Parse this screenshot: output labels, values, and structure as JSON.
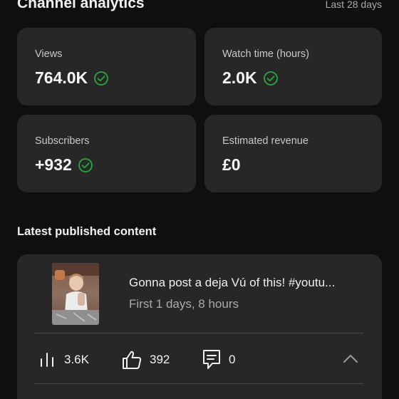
{
  "header": {
    "title": "Channel analytics",
    "range": "Last 28 days"
  },
  "metrics": [
    {
      "label": "Views",
      "value": "764.0K",
      "verified": true
    },
    {
      "label": "Watch time (hours)",
      "value": "2.0K",
      "verified": true
    },
    {
      "label": "Subscribers",
      "value": "+932",
      "verified": true
    },
    {
      "label": "Estimated revenue",
      "value": "£0",
      "verified": false
    }
  ],
  "latest": {
    "section_title": "Latest published content",
    "video": {
      "title": "Gonna post a deja Vú of this! #youtu...",
      "age": "First 1 days, 8 hours",
      "views": "3.6K",
      "likes": "392",
      "comments": "0"
    }
  },
  "icons": {
    "check": "check-circle-icon",
    "views": "bar-chart-icon",
    "likes": "thumbs-up-icon",
    "comments": "comment-icon",
    "collapse": "chevron-up-icon"
  },
  "colors": {
    "background": "#0f0f0f",
    "card": "#272727",
    "check": "#2ba640",
    "muted": "#aaaaaa"
  }
}
